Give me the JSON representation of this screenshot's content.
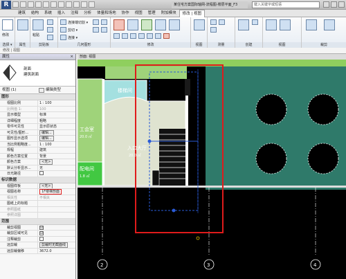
{
  "app": {
    "logo": "R",
    "title": "某住宅方案国际轴网-流程图-楼层平面_F3",
    "search_placeholder": "键入关键字或短语"
  },
  "tabs": [
    "建筑",
    "结构",
    "系统",
    "插入",
    "注释",
    "分析",
    "体量和场地",
    "协作",
    "视图",
    "管理",
    "附加模块",
    "修改 | 视图"
  ],
  "active_tab_index": 11,
  "ribbon": {
    "groups": [
      {
        "label": "选择 ▾"
      },
      {
        "label": "属性"
      },
      {
        "label": "剪贴板"
      },
      {
        "label": "几何图形"
      },
      {
        "label": "修改"
      },
      {
        "label": "视图"
      },
      {
        "label": "测量"
      },
      {
        "label": "创建"
      },
      {
        "label": "视图"
      },
      {
        "label": "裁剪"
      }
    ],
    "items": {
      "modify": "修改",
      "paste": "粘贴",
      "join": "连接端切割 ▾",
      "cut": "剪切 ▾",
      "connect": "连接 ▾",
      "crop_size": "尺寸\n裁剪",
      "reset_crop": "拆分\n区域"
    }
  },
  "options_bar": "修改 | 视图",
  "properties": {
    "header": "属性",
    "close": "×",
    "type_name": "剖面",
    "type_subname": "建筑剖面",
    "type_selector": "视图 (1)",
    "edit_type": "编辑类型",
    "categories": [
      {
        "name": "图形",
        "rows": [
          {
            "k": "视图比例",
            "v": "1 : 100"
          },
          {
            "k": "比例值 1:",
            "v": "100",
            "gray": true
          },
          {
            "k": "显示模型",
            "v": "标准"
          },
          {
            "k": "详细程度",
            "v": "粗略"
          },
          {
            "k": "零件可见性",
            "v": "显示原状态"
          },
          {
            "k": "可见性/图形...",
            "v": "编辑...",
            "btn": true
          },
          {
            "k": "图形显示选项",
            "v": "编辑...",
            "btn": true
          },
          {
            "k": "当比例粗略度...",
            "v": "1 : 100"
          },
          {
            "k": "规程",
            "v": "建筑"
          },
          {
            "k": "颜色方案位置",
            "v": "背景"
          },
          {
            "k": "颜色方案",
            "v": "<无>",
            "btn": true
          },
          {
            "k": "默认分析显示...",
            "v": "无"
          },
          {
            "k": "日光路径",
            "v": "",
            "chk": true
          }
        ]
      },
      {
        "name": "标识数据",
        "rows": [
          {
            "k": "视图样板",
            "v": "<无>",
            "btn": true
          },
          {
            "k": "视图名称",
            "v": "1F楼梯剖面",
            "hl": true
          },
          {
            "k": "相关性",
            "v": "不相关",
            "gray": true
          },
          {
            "k": "图纸上的标题",
            "v": ""
          },
          {
            "k": "参照图纸",
            "v": "",
            "gray": true
          },
          {
            "k": "参照详图",
            "v": "",
            "gray": true
          }
        ]
      },
      {
        "name": "范围",
        "rows": [
          {
            "k": "裁剪视图",
            "v": "☑",
            "chk": true
          },
          {
            "k": "裁剪区域可见",
            "v": "☑",
            "chk": true
          },
          {
            "k": "注释裁剪",
            "v": "",
            "chk": true
          },
          {
            "k": "远剪裁",
            "v": "剪裁时无截面线",
            "btn": true
          },
          {
            "k": "远剪裁偏移",
            "v": "3672.0"
          }
        ]
      }
    ]
  },
  "view_tab": "剖面: 视图",
  "plan": {
    "rooms": [
      {
        "name": "工会室",
        "area": "20.0 ㎡"
      },
      {
        "name": "配电间",
        "area": "1.8 ㎡"
      },
      {
        "name": "楼梯间",
        "area": ""
      },
      {
        "name": "入口大厅",
        "area": "20.0 ㎡"
      }
    ],
    "grid_labels": [
      "2",
      "3",
      "4"
    ],
    "colors": {
      "canvas": "#000000",
      "room_green": "#9fd37a",
      "room_bright": "#42c842",
      "hall": "#dfe3d0",
      "teal": "#2f7a6a",
      "highlight": "#e01b1b",
      "section_line": "#2a5bd7"
    }
  }
}
